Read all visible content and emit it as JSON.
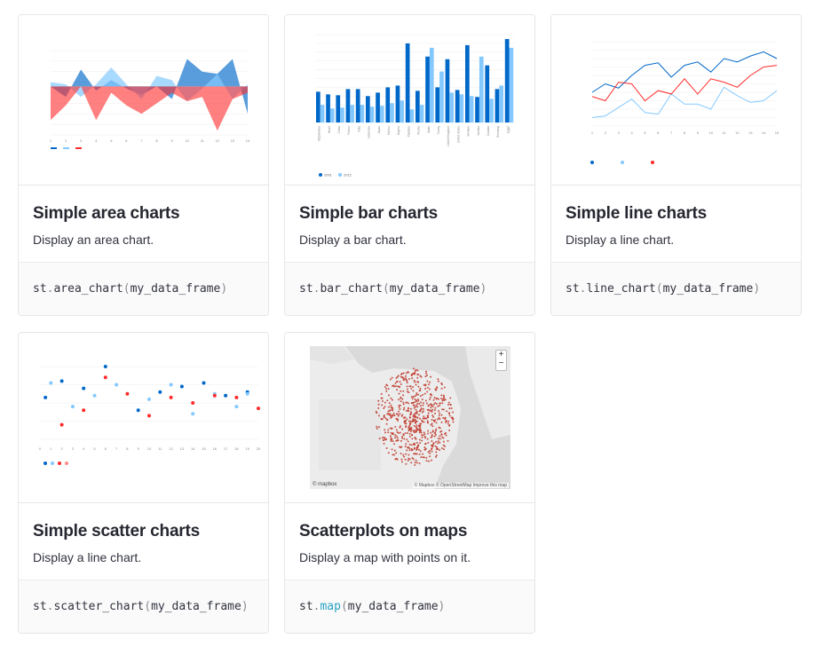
{
  "cards": [
    {
      "title": "Simple area charts",
      "description": "Display an area chart.",
      "code": {
        "obj": "st",
        "dot": ".",
        "fn": "area_chart",
        "open": "(",
        "arg": "my_data_frame",
        "close": ")"
      }
    },
    {
      "title": "Simple bar charts",
      "description": "Display a bar chart.",
      "code": {
        "obj": "st",
        "dot": ".",
        "fn": "bar_chart",
        "open": "(",
        "arg": "my_data_frame",
        "close": ")"
      }
    },
    {
      "title": "Simple line charts",
      "description": "Display a line chart.",
      "code": {
        "obj": "st",
        "dot": ".",
        "fn": "line_chart",
        "open": "(",
        "arg": "my_data_frame",
        "close": ")"
      }
    },
    {
      "title": "Simple scatter charts",
      "description": "Display a line chart.",
      "code": {
        "obj": "st",
        "dot": ".",
        "fn": "scatter_chart",
        "open": "(",
        "arg": "my_data_frame",
        "close": ")"
      }
    },
    {
      "title": "Scatterplots on maps",
      "description": "Display a map with points on it.",
      "code": {
        "obj": "st",
        "dot": ".",
        "fn": "map",
        "open": "(",
        "arg": "my_data_frame",
        "close": ")"
      }
    }
  ],
  "colors": {
    "dark_blue": "#0068c9",
    "light_blue": "#83c9ff",
    "red": "#ff2b2b",
    "pink": "#ff8a8a",
    "map_point": "#c0392b"
  },
  "map": {
    "zoom_in": "+",
    "zoom_out": "−",
    "attribution": "© Mapbox © OpenStreetMap Improve this map",
    "logo": "© mapbox"
  },
  "chart_data": [
    {
      "type": "area",
      "x": [
        1,
        2,
        3,
        4,
        5,
        6,
        7,
        8,
        9,
        10,
        11,
        12,
        13,
        14
      ],
      "series": [
        {
          "values": [
            0.3,
            -0.2,
            1.1,
            0.1,
            0.6,
            0.2,
            -0.1,
            0.3,
            -0.3,
            1.6,
            1.0,
            0.9,
            1.6,
            -1.0
          ]
        },
        {
          "values": [
            0.5,
            0.4,
            -0.2,
            0.4,
            1.2,
            0.4,
            -0.3,
            0.8,
            0.6,
            -0.4,
            0.2,
            0.9,
            -0.3,
            0.4
          ]
        },
        {
          "values": [
            -1.3,
            -0.6,
            0.3,
            -1.3,
            0.0,
            -0.6,
            -1.0,
            -0.5,
            0.0,
            -0.4,
            -0.2,
            -1.8,
            -0.3,
            0.0
          ]
        }
      ],
      "ylim": [
        -2,
        2
      ],
      "legend": "bottom-left"
    },
    {
      "type": "bar",
      "categories": [
        "Afghanistan",
        "Brazil",
        "China",
        "France",
        "India",
        "Indonesia",
        "Japan",
        "Mexico",
        "Nigeria",
        "Pakistan",
        "Russia",
        "Spain",
        "Turkey",
        "United Kingdom",
        "United States",
        "Vietnam",
        "Zambia",
        "Canada",
        "Germany",
        "Egypt"
      ],
      "series": [
        {
          "name": "2001",
          "values": [
            350,
            320,
            310,
            380,
            380,
            300,
            340,
            400,
            420,
            900,
            360,
            750,
            400,
            720,
            370,
            880,
            290,
            650,
            380,
            950
          ]
        },
        {
          "name": "2012",
          "values": [
            200,
            160,
            170,
            200,
            200,
            180,
            190,
            220,
            250,
            150,
            200,
            850,
            580,
            340,
            320,
            300,
            750,
            270,
            420,
            850
          ]
        }
      ],
      "ylim": [
        0,
        1000
      ],
      "legend": "bottom-left"
    },
    {
      "type": "line",
      "x": [
        1,
        2,
        3,
        4,
        5,
        6,
        7,
        8,
        9,
        10,
        11,
        12,
        13,
        14,
        15
      ],
      "series": [
        {
          "values": [
            400,
            500,
            450,
            600,
            720,
            750,
            580,
            720,
            760,
            640,
            800,
            760,
            830,
            880,
            800
          ]
        },
        {
          "values": [
            100,
            120,
            220,
            320,
            160,
            140,
            380,
            260,
            260,
            200,
            460,
            360,
            280,
            300,
            420
          ]
        },
        {
          "values": [
            350,
            300,
            520,
            500,
            300,
            420,
            380,
            560,
            380,
            560,
            520,
            460,
            600,
            700,
            720
          ]
        }
      ],
      "ylim": [
        0,
        1000
      ],
      "legend": "bottom-left"
    },
    {
      "type": "scatter",
      "series": [
        {
          "points": [
            [
              0.5,
              0.3
            ],
            [
              2,
              1.2
            ],
            [
              4,
              0.8
            ],
            [
              6,
              2.0
            ],
            [
              9,
              -0.4
            ],
            [
              11,
              0.6
            ],
            [
              13,
              0.9
            ],
            [
              15,
              1.1
            ],
            [
              17,
              0.4
            ],
            [
              19,
              0.6
            ]
          ]
        },
        {
          "points": [
            [
              1,
              1.1
            ],
            [
              3,
              -0.2
            ],
            [
              5,
              0.4
            ],
            [
              7,
              1.0
            ],
            [
              10,
              0.2
            ],
            [
              12,
              1.0
            ],
            [
              14,
              -0.6
            ],
            [
              16,
              0.5
            ],
            [
              18,
              -0.2
            ],
            [
              19,
              0.5
            ]
          ]
        },
        {
          "points": [
            [
              2,
              -1.2
            ],
            [
              4,
              -0.4
            ],
            [
              6,
              1.4
            ],
            [
              8,
              0.5
            ],
            [
              10,
              -0.7
            ],
            [
              12,
              0.3
            ],
            [
              14,
              0.0
            ],
            [
              16,
              0.4
            ],
            [
              18,
              0.3
            ],
            [
              20,
              -0.3
            ]
          ]
        }
      ],
      "xlim": [
        0,
        20
      ],
      "ylim": [
        -2,
        2
      ],
      "legend": "bottom-left"
    }
  ]
}
